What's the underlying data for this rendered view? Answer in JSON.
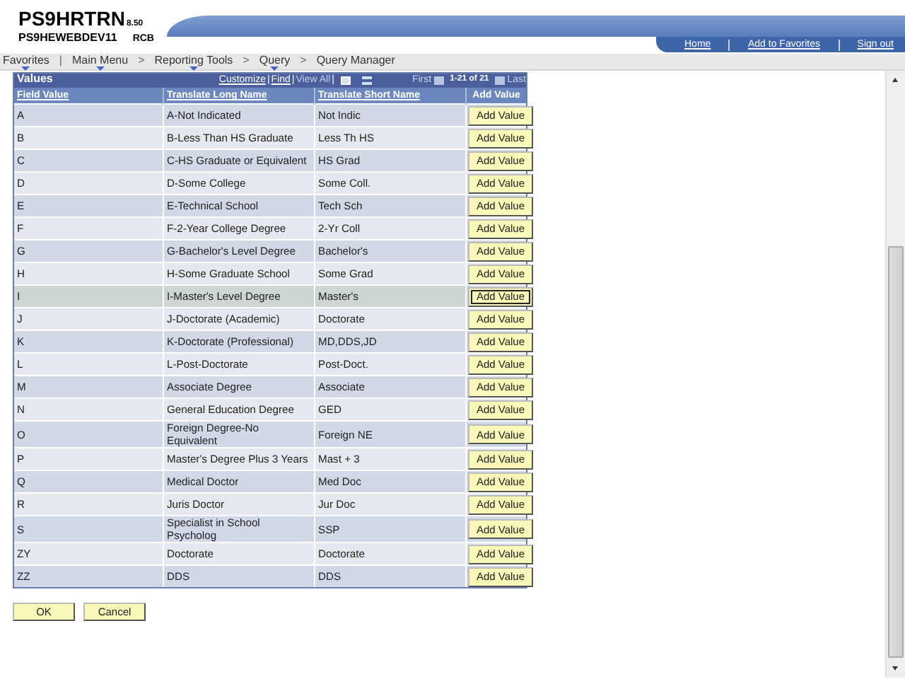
{
  "header": {
    "database": "PS9HRTRN",
    "version": "8.50",
    "server": "PS9HEWEBDEV11",
    "user": "RCB",
    "links": [
      "Home",
      "Add to Favorites",
      "Sign out"
    ]
  },
  "breadcrumb": [
    {
      "label": "Favorites",
      "menu": true,
      "separator": "|"
    },
    {
      "label": "Main Menu",
      "menu": true,
      "separator": ">"
    },
    {
      "label": "Reporting Tools",
      "menu": true,
      "separator": ">"
    },
    {
      "label": "Query",
      "menu": true,
      "separator": ">"
    },
    {
      "label": "Query Manager",
      "menu": false
    }
  ],
  "grid": {
    "title": "Values",
    "toolbar": [
      {
        "kind": "link",
        "text": "Customize"
      },
      {
        "kind": "separator",
        "text": "|"
      },
      {
        "kind": "link",
        "text": "Find"
      },
      {
        "kind": "separator",
        "text": "|"
      },
      {
        "kind": "disabled",
        "text": "View All"
      },
      {
        "kind": "separator",
        "text": "|"
      },
      {
        "kind": "download"
      },
      {
        "kind": "gridview"
      },
      {
        "kind": "disabled",
        "text": "First"
      },
      {
        "kind": "previous"
      },
      {
        "kind": "range",
        "text": "1-21 of 21"
      },
      {
        "kind": "next"
      },
      {
        "kind": "disabled",
        "text": "Last"
      }
    ],
    "columns": [
      {
        "label": "Field Value",
        "link": true
      },
      {
        "label": "Translate Long Name",
        "link": true
      },
      {
        "label": "Translate Short Name",
        "link": true
      },
      {
        "label": "Add Value",
        "link": false
      }
    ],
    "rows": [
      {
        "value": "A",
        "long": "A-Not Indicated",
        "short": "Not Indic",
        "button": "Add Value",
        "selected": false
      },
      {
        "value": "B",
        "long": "B-Less Than HS Graduate",
        "short": "Less Th HS",
        "button": "Add Value",
        "selected": false
      },
      {
        "value": "C",
        "long": "C-HS Graduate or Equivalent",
        "short": "HS Grad",
        "button": "Add Value",
        "selected": false
      },
      {
        "value": "D",
        "long": "D-Some College",
        "short": "Some Coll.",
        "button": "Add Value",
        "selected": false
      },
      {
        "value": "E",
        "long": "E-Technical School",
        "short": "Tech Sch",
        "button": "Add Value",
        "selected": false
      },
      {
        "value": "F",
        "long": "F-2-Year College Degree",
        "short": "2-Yr Coll",
        "button": "Add Value",
        "selected": false
      },
      {
        "value": "G",
        "long": "G-Bachelor's Level Degree",
        "short": "Bachelor's",
        "button": "Add Value",
        "selected": false
      },
      {
        "value": "H",
        "long": "H-Some Graduate School",
        "short": "Some Grad",
        "button": "Add Value",
        "selected": false
      },
      {
        "value": "I",
        "long": "I-Master's Level Degree",
        "short": "Master's",
        "button": "Add Value",
        "selected": true
      },
      {
        "value": "J",
        "long": "J-Doctorate (Academic)",
        "short": "Doctorate",
        "button": "Add Value",
        "selected": false
      },
      {
        "value": "K",
        "long": "K-Doctorate (Professional)",
        "short": "MD,DDS,JD",
        "button": "Add Value",
        "selected": false
      },
      {
        "value": "L",
        "long": "L-Post-Doctorate",
        "short": "Post-Doct.",
        "button": "Add Value",
        "selected": false
      },
      {
        "value": "M",
        "long": "Associate Degree",
        "short": "Associate",
        "button": "Add Value",
        "selected": false
      },
      {
        "value": "N",
        "long": "General Education Degree",
        "short": "GED",
        "button": "Add Value",
        "selected": false
      },
      {
        "value": "O",
        "long": "Foreign Degree-No Equivalent",
        "short": "Foreign NE",
        "button": "Add Value",
        "selected": false
      },
      {
        "value": "P",
        "long": "Master's Degree Plus 3 Years",
        "short": "Mast + 3",
        "button": "Add Value",
        "selected": false
      },
      {
        "value": "Q",
        "long": "Medical Doctor",
        "short": "Med Doc",
        "button": "Add Value",
        "selected": false
      },
      {
        "value": "R",
        "long": "Juris Doctor",
        "short": "Jur Doc",
        "button": "Add Value",
        "selected": false
      },
      {
        "value": "S",
        "long": "Specialist in School Psycholog",
        "short": "SSP",
        "button": "Add Value",
        "selected": false
      },
      {
        "value": "ZY",
        "long": "Doctorate",
        "short": "Doctorate",
        "button": "Add Value",
        "selected": false
      },
      {
        "value": "ZZ",
        "long": "DDS",
        "short": "DDS",
        "button": "Add Value",
        "selected": false
      }
    ]
  },
  "buttons": [
    "OK",
    "Cancel"
  ]
}
